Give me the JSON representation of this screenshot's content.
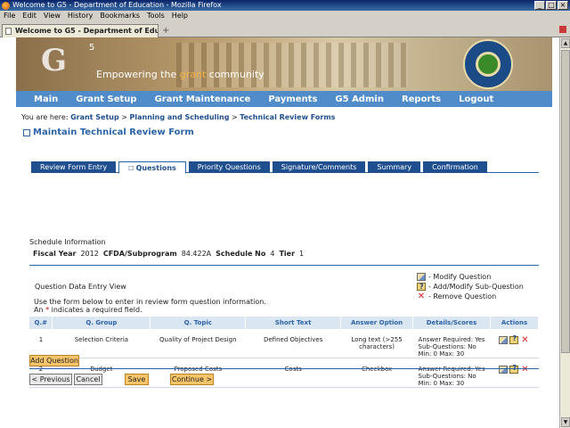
{
  "window": {
    "title": "Welcome to G5 - Department of Education - Mozilla Firefox"
  },
  "menu": [
    "File",
    "Edit",
    "View",
    "History",
    "Bookmarks",
    "Tools",
    "Help"
  ],
  "browser_tab": {
    "label": "Welcome to G5 - Department of Edu...",
    "close": "×",
    "new_tab": "+"
  },
  "banner": {
    "logo_letter": "G",
    "logo_number": "5",
    "tagline_pre": "Empowering the ",
    "tagline_highlight": "grant",
    "tagline_post": " community"
  },
  "nav": [
    "Main",
    "Grant Setup",
    "Grant Maintenance",
    "Payments",
    "G5 Admin",
    "Reports",
    "Logout"
  ],
  "breadcrumb": {
    "prefix": "You are here: ",
    "items": [
      "Grant Setup",
      "Planning and Scheduling",
      "Technical Review Forms"
    ],
    "separator": " > "
  },
  "page_title": "Maintain Technical Review Form",
  "tabs": [
    {
      "label": "Review Form Entry",
      "active": false
    },
    {
      "label": "Questions",
      "active": true
    },
    {
      "label": "Priority Questions",
      "active": false
    },
    {
      "label": "Signature/Comments",
      "active": false
    },
    {
      "label": "Summary",
      "active": false
    },
    {
      "label": "Confirmation",
      "active": false
    }
  ],
  "schedule": {
    "label": "Schedule Information",
    "fiscal_year_label": "Fiscal Year",
    "fiscal_year": "2012",
    "cfda_label": "CFDA/Subprogram",
    "cfda": "84.422A",
    "schedule_no_label": "Schedule No",
    "schedule_no": "4",
    "tier_label": "Tier",
    "tier": "1"
  },
  "question_view": {
    "label": "Question Data Entry View",
    "instructions_line1": "Use the form below to enter in review form question information.",
    "instructions_line2_pre": "An ",
    "required_marker": "*",
    "instructions_line2_post": " indicates a required field."
  },
  "legend": [
    {
      "icon": "modify-icon",
      "label": "- Modify Question"
    },
    {
      "icon": "add-modify-sub-question-icon",
      "label": "- Add/Modify Sub-Question"
    },
    {
      "icon": "remove-icon",
      "label": "- Remove Question"
    }
  ],
  "table": {
    "headers": [
      "Q.#",
      "Q. Group",
      "Q. Topic",
      "Short Text",
      "Answer Option",
      "Details/Scores",
      "Actions"
    ],
    "rows": [
      {
        "num": "1",
        "group": "Selection Criteria",
        "topic": "Quality of Project Design",
        "short_text": "Defined Objectives",
        "answer_line1": "Long text (>255",
        "answer_line2": "characters)",
        "details_line1": "Answer Required: Yes",
        "details_line2": "Sub-Questions: No",
        "details_line3": "Min: 0 Max: 30"
      },
      {
        "num": "2",
        "group": "Budget",
        "topic": "Proposed Costs",
        "short_text": "Costs",
        "answer_line1": "Checkbox",
        "answer_line2": "",
        "details_line1": "Answer Required: Yes",
        "details_line2": "Sub-Questions: No",
        "details_line3": "Min: 0 Max: 30"
      }
    ]
  },
  "buttons": {
    "add_question": "Add Question",
    "previous": "< Previous",
    "cancel": "Cancel",
    "save": "Save",
    "continue": "Continue >"
  },
  "colors": {
    "nav_blue": "#4f8cc9",
    "tab_blue": "#1f4f8f",
    "button_orange": "#f7c46a",
    "title_blue": "#2b64a8"
  }
}
